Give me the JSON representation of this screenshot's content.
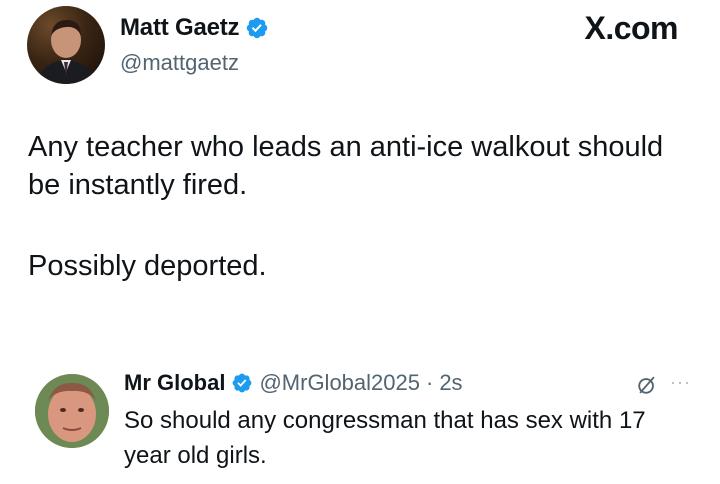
{
  "tweet": {
    "author_name": "Matt Gaetz",
    "author_handle": "@mattgaetz",
    "brand": "X.com",
    "line1": "Any teacher who leads an anti-ice walkout should",
    "line2": "be instantly fired.",
    "line3": "Possibly deported."
  },
  "reply": {
    "author_name": "Mr Global",
    "author_handle": "@MrGlobal2025",
    "separator": "·",
    "time": "2s",
    "line1": "So should any congressman that has sex with 17",
    "line2": "year old girls."
  },
  "icons": {
    "verified": "verified-badge-icon",
    "grok": "grok-icon",
    "more": "more-icon"
  },
  "colors": {
    "verified": "#1d9bf0",
    "text": "#0f1419",
    "secondary": "#536471"
  }
}
